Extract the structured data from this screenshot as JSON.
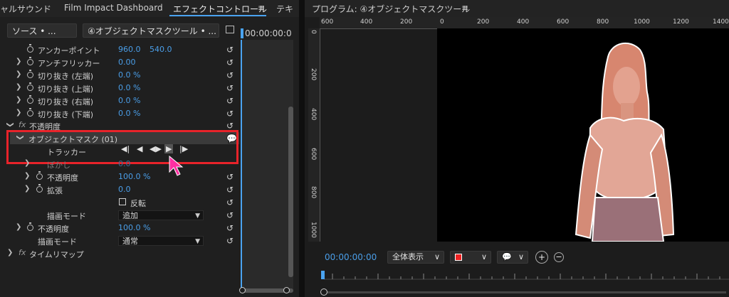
{
  "left_tabs": [
    "ャルサウンド",
    "Film Impact Dashboard",
    "エフェクトコントロール",
    "テキ"
  ],
  "tab_menu_icon": "≡",
  "source_button": "ソース • ...",
  "clip_button": "④オブジェクトマスクツール • ...",
  "timecode_left": "00:00:00:0",
  "properties": {
    "anchor": {
      "label": "アンカーポイント",
      "x": "960.0",
      "y": "540.0"
    },
    "antiflicker": {
      "label": "アンチフリッカー",
      "value": "0.00"
    },
    "crop_left": {
      "label": "切り抜き (左端)",
      "value": "0.0 %"
    },
    "crop_top": {
      "label": "切り抜き (上端)",
      "value": "0.0 %"
    },
    "crop_right": {
      "label": "切り抜き (右端)",
      "value": "0.0 %"
    },
    "crop_bottom": {
      "label": "切り抜き (下端)",
      "value": "0.0 %"
    },
    "opacity_group": {
      "label": "不透明度"
    },
    "object_mask": {
      "label": "オブジェクトマスク (01)"
    },
    "tracker": {
      "label": "トラッカー"
    },
    "mask_hidden": {
      "label": "ぼかし",
      "value": "0.0"
    },
    "mask_opacity": {
      "label": "不透明度",
      "value": "100.0 %"
    },
    "expansion": {
      "label": "拡張",
      "value": "0.0"
    },
    "invert": {
      "label": "反転"
    },
    "blend_mode": {
      "label": "描画モード",
      "value": "追加"
    },
    "opacity": {
      "label": "不透明度",
      "value": "100.0 %"
    },
    "blend_mode2": {
      "label": "描画モード",
      "value": "通常"
    },
    "time_remap": {
      "label": "タイムリマップ"
    }
  },
  "tracker_controls": [
    "◀|",
    "◀",
    "◀▶",
    "▶",
    "|▶"
  ],
  "program": {
    "title": "プログラム: ④オブジェクトマスクツール",
    "menu_icon": "≡",
    "ruler_h": [
      "600",
      "400",
      "200",
      "0",
      "200",
      "400",
      "600",
      "800",
      "1000",
      "1200",
      "1400"
    ],
    "ruler_v": [
      "0",
      "200",
      "400",
      "600",
      "800",
      "1000"
    ],
    "timecode": "00:00:00:00",
    "fit_label": "全体表示",
    "fit_caret": "∨"
  },
  "colors": {
    "accent": "#4aa3f0",
    "highlight": "#e8232a",
    "value_blue": "#4a9ee8"
  }
}
